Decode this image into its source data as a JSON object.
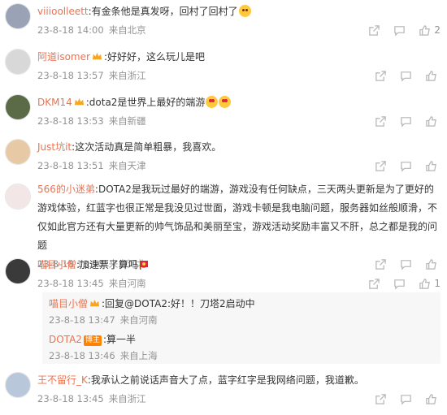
{
  "comments": [
    {
      "username": "viiioolleett",
      "text": ":有金条他是真发呀，回村了回村了",
      "time": "23-8-18 14:00",
      "location": "来自北京",
      "likes": "2",
      "avatar_bg": "#9aa3b5"
    },
    {
      "username": "阿道isomer",
      "text": ":好好好，这么玩儿是吧",
      "time": "23-8-18 13:57",
      "location": "来自浙江",
      "likes": "",
      "avatar_bg": "#d8d8d8"
    },
    {
      "username": "DKM14",
      "text": ":dota2是世界上最好的端游",
      "time": "23-8-18 13:53",
      "location": "来自新疆",
      "likes": "",
      "avatar_bg": "#5b6b47"
    },
    {
      "username": "Just坑it",
      "text": ":这次活动真是简单粗暴，我喜欢。",
      "time": "23-8-18 13:51",
      "location": "来自天津",
      "likes": "",
      "avatar_bg": "#e8c9a6"
    },
    {
      "username": "566的小迷弟",
      "text": ":DOTA2是我玩过最好的端游，游戏没有任何缺点，三天两头更新是为了更好的游戏体验，红蓝字也很正常是我没见过世面，游戏卡顿是我电脑问题，服务器如丝般顺滑，不仅如此官方还有大量更新的帅气饰品和美丽至宝，游戏活动奖励丰富又不肝，总之都是我的问题",
      "time": "23-8-18 13:50",
      "location": "来自河北",
      "likes": "",
      "avatar_bg": "#f3e6e6"
    },
    {
      "username": "喵目小僧",
      "text": ":加速票了算吗",
      "time": "23-8-18 13:45",
      "location": "来自河南",
      "likes": "1",
      "avatar_bg": "#3a3a3a"
    },
    {
      "username": "王不留行_K",
      "text": ":我承认之前说话声音大了点，蓝字红字是我网络问题，我道歉。",
      "time": "23-8-18 13:45",
      "location": "来自浙江",
      "likes": "",
      "avatar_bg": "#b8c7d9"
    }
  ],
  "replies": [
    {
      "username": "喵目小僧",
      "text": ":回复@DOTA2:好！！刀塔2启动中",
      "time": "23-8-18 13:47",
      "location": "来自河南"
    },
    {
      "username": "DOTA2",
      "author_tag": "博主",
      "text": ":算一半",
      "time": "23-8-18 13:46",
      "location": "来自上海"
    }
  ],
  "icons": {
    "share": "share-icon",
    "comment": "comment-icon",
    "like": "like-icon"
  },
  "colors": {
    "username": "#eb7350",
    "meta": "#939393",
    "author_tag": "#ff8200",
    "reply_bg": "#f7f7f7"
  }
}
